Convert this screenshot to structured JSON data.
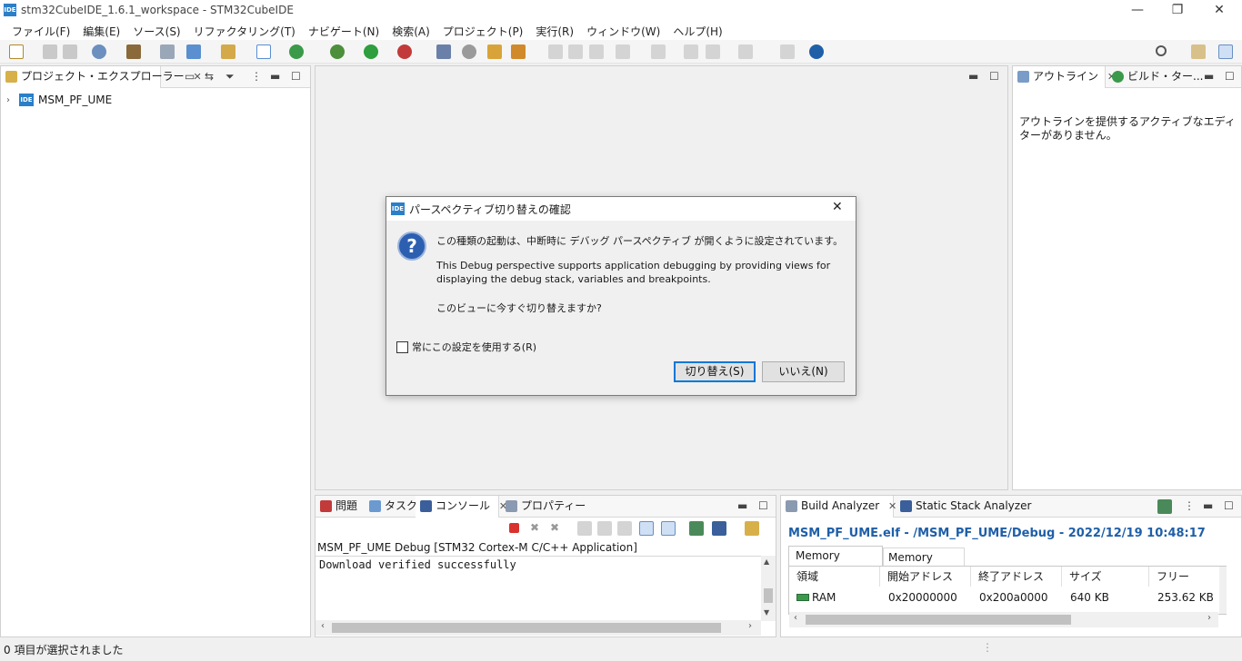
{
  "window": {
    "title": "stm32CubeIDE_1.6.1_workspace - STM32CubeIDE",
    "app_icon_text": "IDE",
    "minimize": "—",
    "restore": "❐",
    "close": "✕"
  },
  "menu": [
    "ファイル(F)",
    "編集(E)",
    "ソース(S)",
    "リファクタリング(T)",
    "ナビゲート(N)",
    "検索(A)",
    "プロジェクト(P)",
    "実行(R)",
    "ウィンドウ(W)",
    "ヘルプ(H)"
  ],
  "explorer": {
    "tab_label": "プロジェクト・エクスプローラー",
    "project_name": "MSM_PF_UME",
    "project_icon_text": "IDE"
  },
  "outline": {
    "tab_label": "アウトライン",
    "build_tab_label": "ビルド・ター...",
    "empty_message": "アウトラインを提供するアクティブなエディターがありません。"
  },
  "bottom_tabs": {
    "problems": "問題",
    "tasks": "タスク",
    "console": "コンソール",
    "properties": "プロパティー"
  },
  "console": {
    "header": "MSM_PF_UME Debug [STM32 Cortex-M C/C++ Application]",
    "output": "Download verified successfully"
  },
  "build_analyzer": {
    "tab_label": "Build Analyzer",
    "stack_tab_label": "Static Stack Analyzer",
    "file_info": "MSM_PF_UME.elf - /MSM_PF_UME/Debug - 2022/12/19 10:48:17",
    "subtabs": [
      "Memory Regions",
      "Memory Details"
    ],
    "columns": [
      "領域",
      "開始アドレス",
      "終了アドレス",
      "サイズ",
      "フリー"
    ],
    "rows": [
      {
        "region": "RAM",
        "start": "0x20000000",
        "end": "0x200a0000",
        "size": "640 KB",
        "free": "253.62 KB"
      }
    ]
  },
  "dialog": {
    "title": "パースペクティブ切り替えの確認",
    "icon_text": "IDE",
    "question_icon": "?",
    "message_1": "この種類の起動は、中断時に デバッグ パースペクティブ が開くように設定されています。",
    "message_2_line1": "This Debug perspective supports application debugging by providing views for",
    "message_2_line2": "displaying the debug stack, variables and breakpoints.",
    "message_3": "このビューに今すぐ切り替えますか?",
    "checkbox_label": "常にこの設定を使用する(R)",
    "checkbox_checked": false,
    "yes_button": "切り替え(S)",
    "no_button": "いいえ(N)",
    "close_glyph": "✕"
  },
  "status": {
    "text": "0 項目が選択されました"
  },
  "colors": {
    "accent": "#0078d7",
    "file_info": "#1f5fa8",
    "ide_icon": "#2a7fc8",
    "stop_red": "#d9322c"
  }
}
